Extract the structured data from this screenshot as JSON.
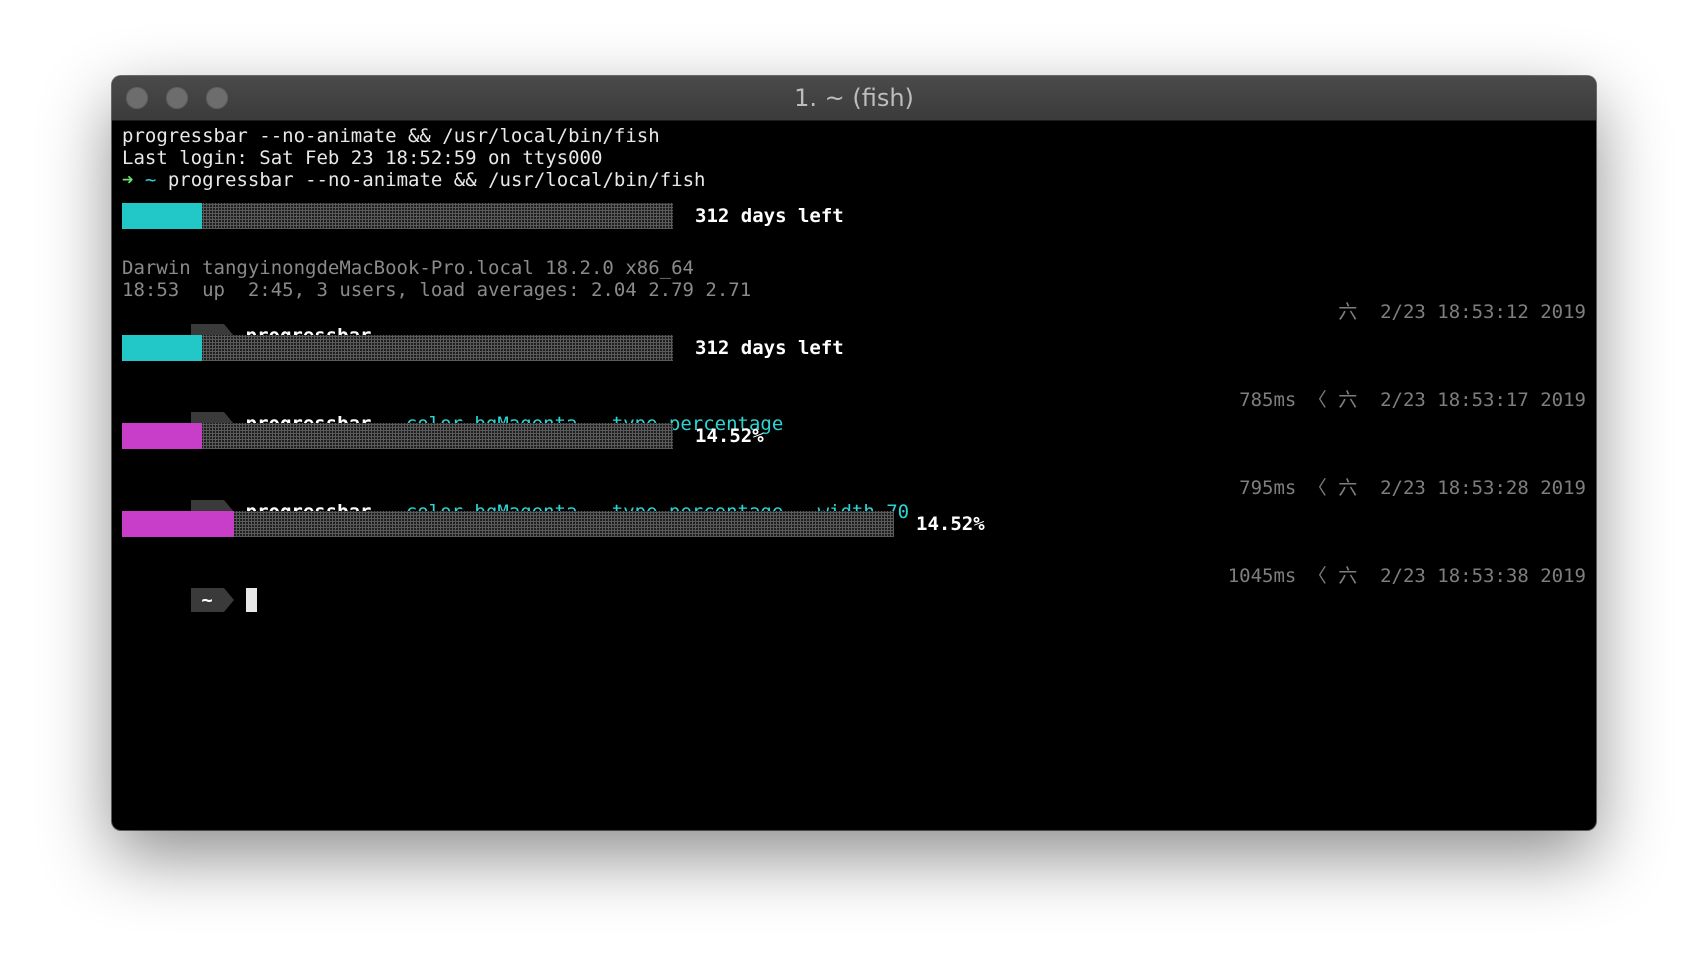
{
  "window": {
    "title": "1. ~ (fish)"
  },
  "session": {
    "line1": "progressbar --no-animate && /usr/local/bin/fish",
    "line2": "Last login: Sat Feb 23 18:52:59 on ttys000",
    "line3": {
      "arrow": "➜",
      "tilde": "~",
      "cmd": "progressbar --no-animate && /usr/local/bin/fish"
    }
  },
  "bars": [
    {
      "progress": 0.1452,
      "color": "#22c8c8",
      "label": "312 days left"
    },
    {
      "progress": 0.1452,
      "color": "#22c8c8",
      "label": "312 days left"
    },
    {
      "progress": 0.1452,
      "color": "#c83ec8",
      "label": "14.52%"
    },
    {
      "progress": 0.1452,
      "color": "#c83ec8",
      "label": "14.52%"
    }
  ],
  "sysinfo": {
    "line1": "Darwin tangyinongdeMacBook-Pro.local 18.2.0 x86_64",
    "line2": "18:53  up  2:45, 3 users, load averages: 2.04 2.79 2.71"
  },
  "prompts": [
    {
      "badge": "~",
      "command": "progressbar",
      "args": "",
      "right": "六  2/23 18:53:12 2019"
    },
    {
      "badge": "~",
      "command": "progressbar",
      "args": " --color bgMagenta --type percentage",
      "right": "785ms 〈 六  2/23 18:53:17 2019"
    },
    {
      "badge": "~",
      "command": "progressbar",
      "args": " --color bgMagenta --type percentage --width 70",
      "right": "795ms 〈 六  2/23 18:53:28 2019"
    },
    {
      "badge": "~",
      "command": "",
      "args": "",
      "right": "1045ms 〈 六  2/23 18:53:38 2019"
    }
  ]
}
